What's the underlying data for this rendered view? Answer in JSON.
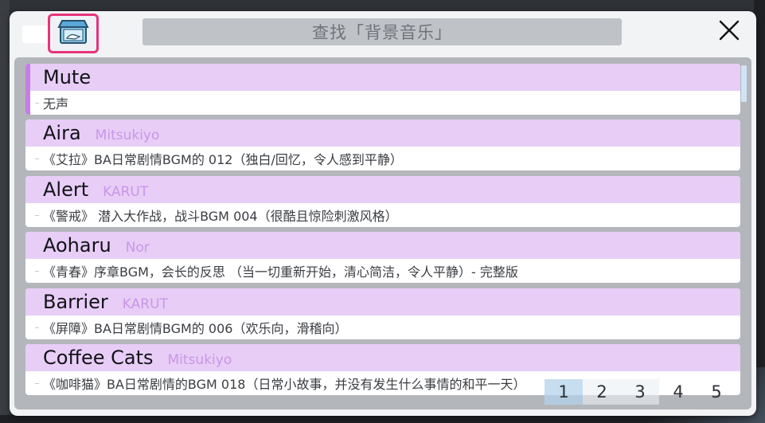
{
  "header": {
    "search_placeholder": "查找「背景音乐」"
  },
  "tracks": [
    {
      "title": "Mute",
      "artist": "",
      "desc": "无声",
      "selected": true
    },
    {
      "title": "Aira",
      "artist": "Mitsukiyo",
      "desc": "《艾拉》BA日常剧情BGM的 012（独白/回忆，令人感到平静）"
    },
    {
      "title": "Alert",
      "artist": "KARUT",
      "desc": "《警戒》 潜入大作战，战斗BGM 004（很酷且惊险刺激风格）"
    },
    {
      "title": "Aoharu",
      "artist": "Nor",
      "desc": "《青春》序章BGM，会长的反思 （当一切重新开始，清心简洁，令人平静）- 完整版"
    },
    {
      "title": "Barrier",
      "artist": "KARUT",
      "desc": "《屏障》BA日常剧情BGM的 006（欢乐向，滑稽向）"
    },
    {
      "title": "Coffee Cats",
      "artist": "Mitsukiyo",
      "desc": "《咖啡猫》BA日常剧情的BGM 018（日常小故事，并没有发生什么事情的和平一天）"
    }
  ],
  "pagination": {
    "pages": [
      "1",
      "2",
      "3",
      "4",
      "5"
    ],
    "current": "1"
  },
  "colors": {
    "accent_pink": "#e8337a",
    "row_header": "#e8cdf7",
    "artist_text": "#c996e8",
    "selected_bar": "#c67ee6"
  },
  "icons": {
    "music_box": "music-box-icon",
    "close": "close-icon"
  }
}
